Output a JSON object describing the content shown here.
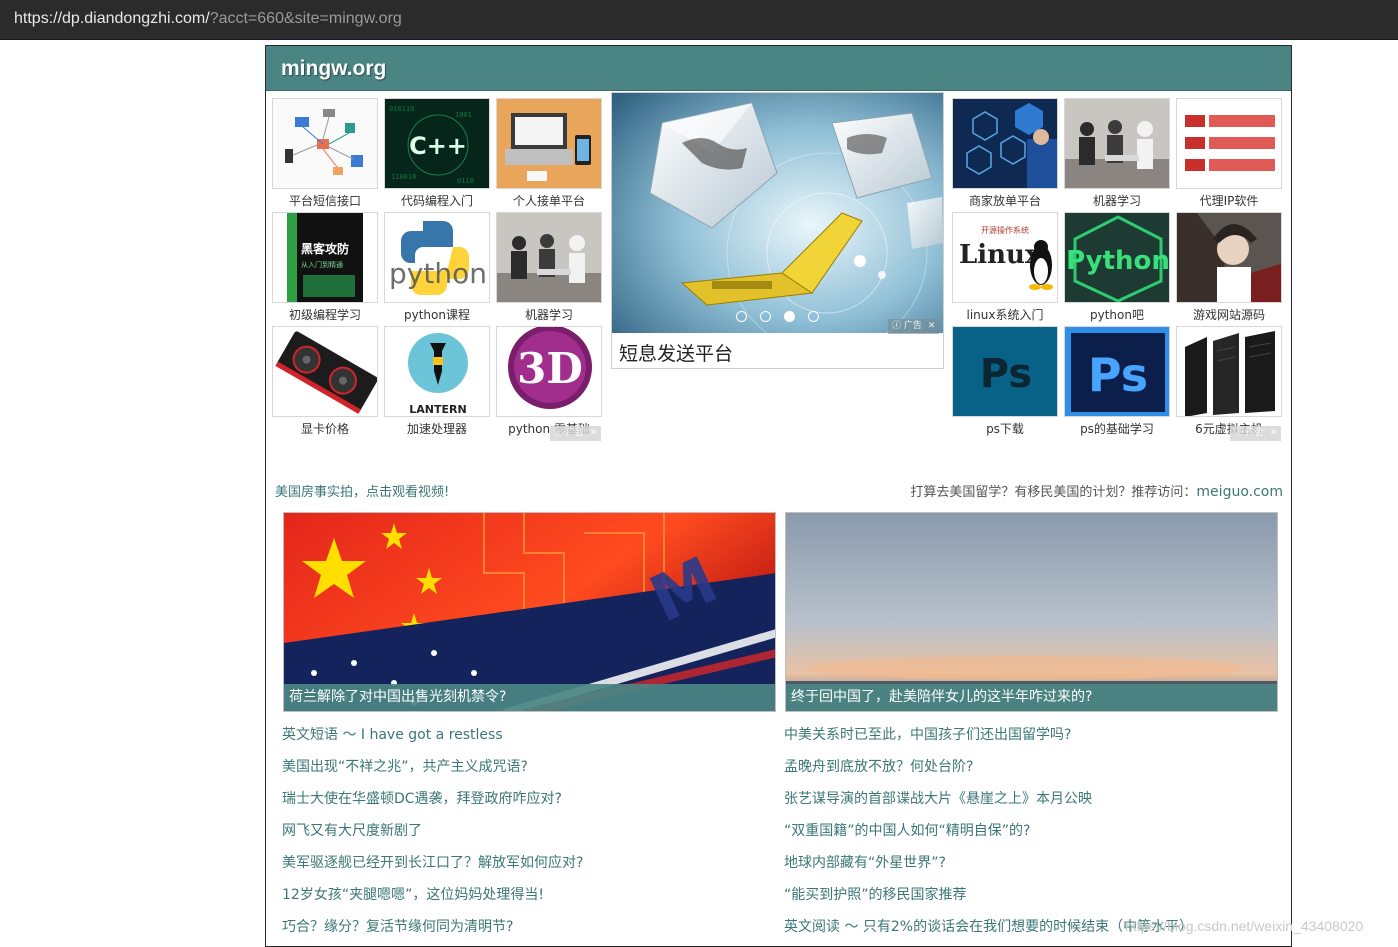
{
  "browser": {
    "url_host": "https://dp.diandongzhi.com/",
    "url_query": "?acct=660&site=mingw.org"
  },
  "site": {
    "title": "mingw.org"
  },
  "left_tiles": [
    {
      "label": "平台短信接口"
    },
    {
      "label": "代码编程入门"
    },
    {
      "label": "个人接单平台"
    },
    {
      "label": "初级编程学习"
    },
    {
      "label": "python课程"
    },
    {
      "label": "机器学习"
    },
    {
      "label": "显卡价格"
    },
    {
      "label": "加速处理器"
    },
    {
      "label": "python 零基础"
    }
  ],
  "right_tiles": [
    {
      "label": "商家放单平台"
    },
    {
      "label": "机器学习"
    },
    {
      "label": "代理IP软件"
    },
    {
      "label": "linux系统入门"
    },
    {
      "label": "python吧"
    },
    {
      "label": "游戏网站源码"
    },
    {
      "label": "ps下载"
    },
    {
      "label": "ps的基础学习"
    },
    {
      "label": "6元虚拟主机"
    }
  ],
  "tile_image_text": {
    "cpp": "C++",
    "python": "python",
    "hacker_line1": "黑客攻防",
    "hacker_line2": "从入门到精通",
    "lantern": "LANTERN",
    "threed": "3D",
    "linux_top": "开源操作系统",
    "linux": "Linux",
    "python_logo": "Python",
    "ps": "Ps"
  },
  "slider": {
    "caption": "短息发送平台",
    "slide_count": 4,
    "active_index": 2
  },
  "ad_tag": {
    "label": "广告",
    "close": "✕"
  },
  "ad_links": {
    "left": "美国房事实拍，点击观看视频!",
    "right_text": "打算去美国留学？有移民美国的计划？推荐访问：",
    "right_link": "meiguo.com"
  },
  "features": [
    {
      "title": "荷兰解除了对中国出售光刻机禁令?"
    },
    {
      "title": "终于回中国了，赴美陪伴女儿的这半年咋过来的?"
    }
  ],
  "news_left": [
    "英文短语 ～ I have got a restless",
    "美国出现“不祥之兆”，共产主义成咒语?",
    "瑞士大使在华盛顿DC遇袭，拜登政府咋应对?",
    "网飞又有大尺度新剧了",
    "美军驱逐舰已经开到长江口了？解放军如何应对?",
    "12岁女孩“夹腿嗯嗯”，这位妈妈处理得当!",
    "巧合？缘分？复活节缘何同为清明节?"
  ],
  "news_right": [
    "中美关系时已至此，中国孩子们还出国留学吗?",
    "孟晚舟到底放不放？何处台阶?",
    "张艺谋导演的首部谍战大片《悬崖之上》本月公映",
    "“双重国籍”的中国人如何“精明自保”的?",
    "地球内部藏有“外星世界”?",
    "“能买到护照”的移民国家推荐",
    "英文阅读 ～ 只有2%的谈话会在我们想要的时候结束（中等水平）"
  ],
  "watermark": "https://blog.csdn.net/weixin_43408020"
}
